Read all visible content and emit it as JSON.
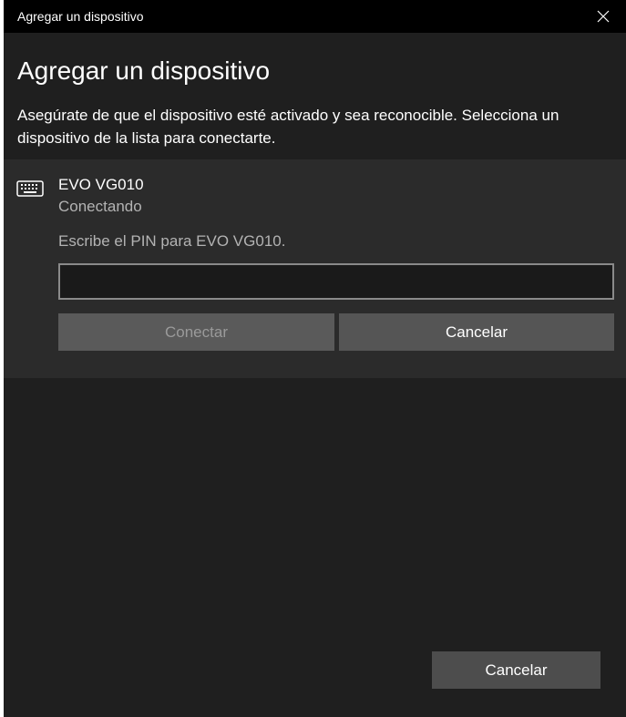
{
  "window": {
    "title": "Agregar un dispositivo"
  },
  "header": {
    "title": "Agregar un dispositivo",
    "instructions": "Asegúrate de que el dispositivo esté activado y sea reconocible. Selecciona un dispositivo de la lista para conectarte."
  },
  "device": {
    "icon": "keyboard-icon",
    "name": "EVO VG010",
    "status": "Conectando",
    "pin_prompt": "Escribe el PIN para EVO VG010.",
    "pin_value": "",
    "connect_label": "Conectar",
    "cancel_label": "Cancelar"
  },
  "footer": {
    "cancel_label": "Cancelar"
  },
  "colors": {
    "titlebar": "#000000",
    "background": "#1f1f1f",
    "panel": "#2b2b2b"
  }
}
